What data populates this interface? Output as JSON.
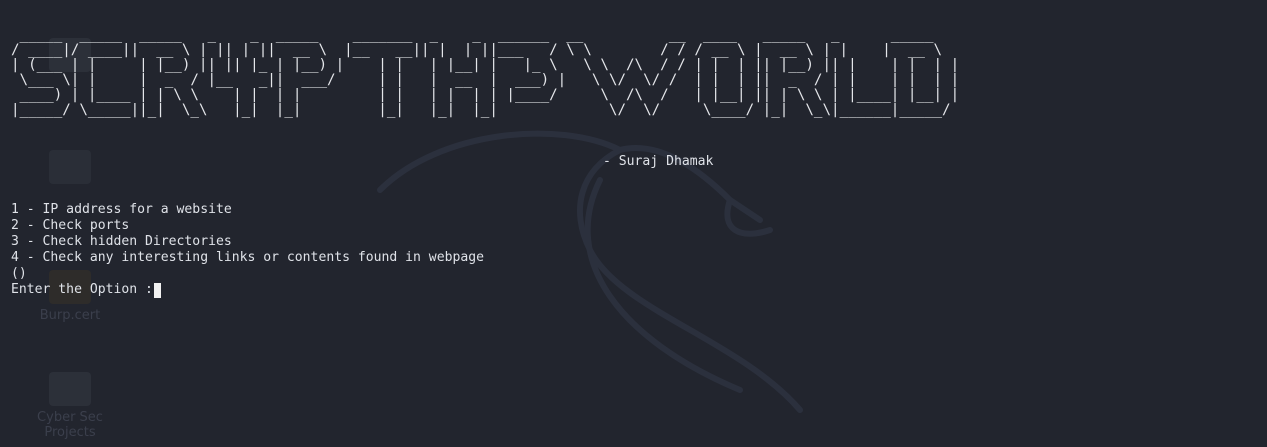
{
  "desktop": {
    "icons": [
      {
        "label": "",
        "icon": "app-icon"
      },
      {
        "label": "",
        "icon": "home-folder-icon"
      },
      {
        "label": "Burp.cert",
        "icon": "certificate-icon"
      },
      {
        "label": "Cyber Sec Projects",
        "icon": "folder-icon"
      }
    ]
  },
  "terminal": {
    "banner": " _____  _____  _____   _    _  _____    _______  _    _  ______  __          __  ____   _____   _      _____  \n/ ____|/ ____||  __ \\ | || | ||  __ \\  |__   __|| |  | ||___   / \\ \\        / / / __ \\ |  __ \\ | |    |  __ \\ \n| (___ | |     | |__) || || |_ | |__) |    | |   | |__| |   |_ \\   \\ \\  /\\  / / | |  | || |__) || |    | |  | |\n \\___ \\| |     |  _  / |__   _||  ___/     | |   |  __  |  ___) |   \\ \\/  \\/ /  | |  | ||  _  / | |    | |  | |\n ____) | |____ | | \\ \\    | |  | |         | |   | |  | | |____/     \\  /\\  /   | |__| || | \\ \\ | |____| |__| |\n|_____/ \\_____||_|  \\_\\   |_|  |_|         |_|   |_|  |_|             \\/  \\/     \\____/ |_|  \\_\\|______|_____/ ",
    "author": "- Suraj Dhamak",
    "menu": [
      "1 - IP address for a website",
      "2 - Check ports",
      "3 - Check hidden Directories",
      "4 - Check any interesting links or contents found in webpage",
      "()"
    ],
    "prompt": "Enter the Option :"
  },
  "colors": {
    "background": "#22252e",
    "text": "#dfe2e8",
    "cursor": "#f2f2f2"
  }
}
